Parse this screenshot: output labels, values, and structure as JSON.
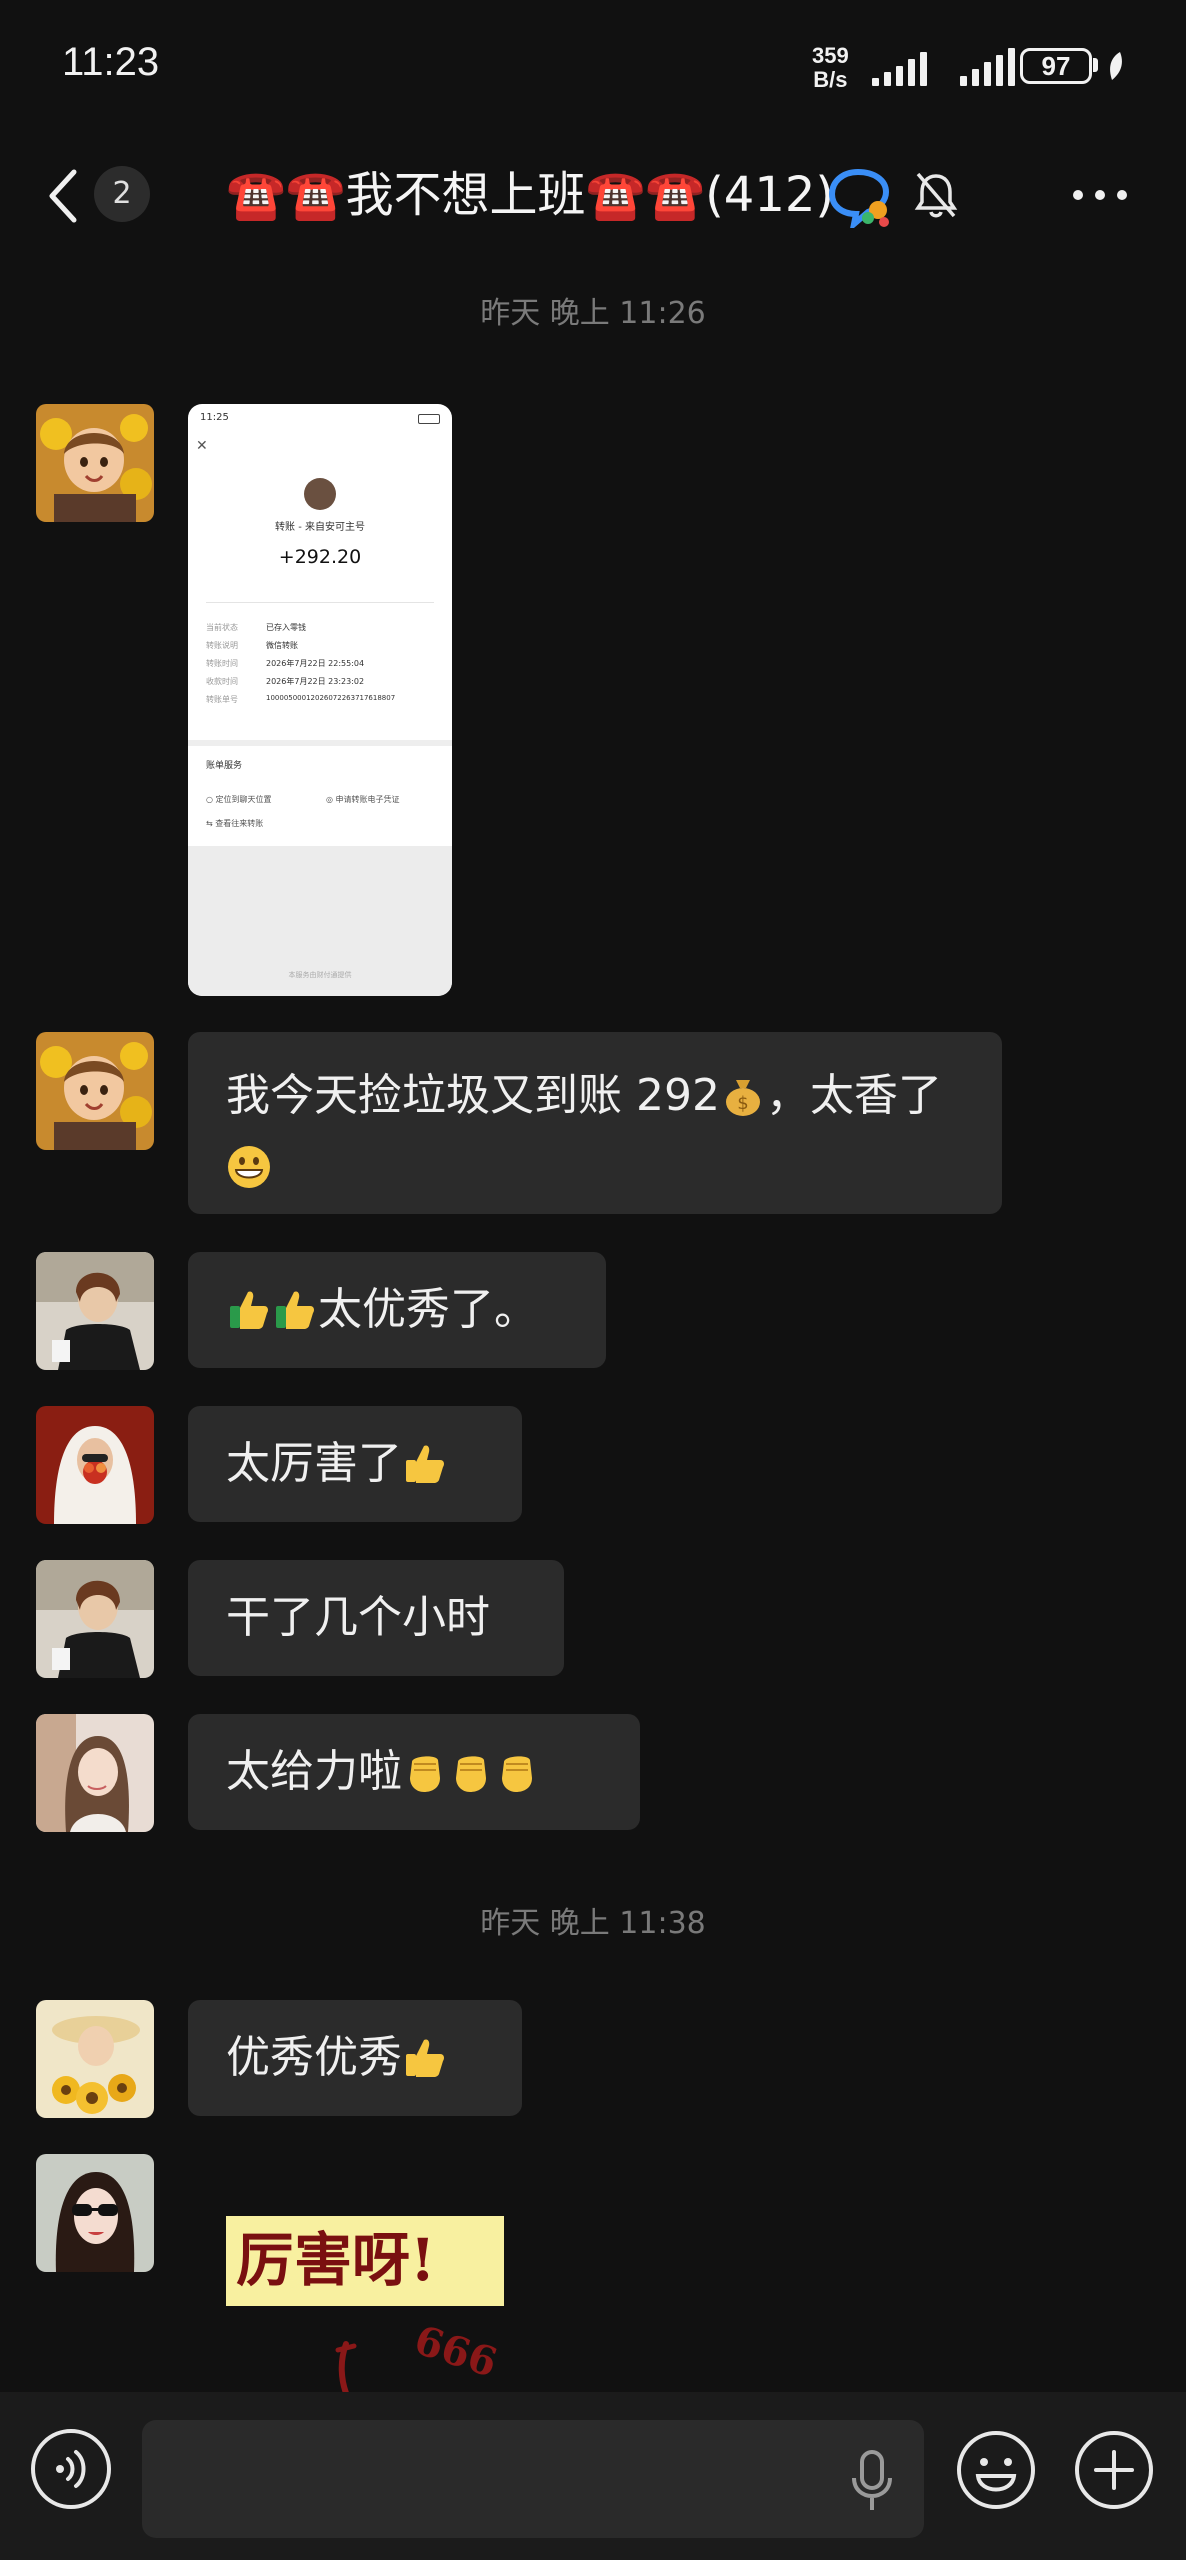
{
  "status_bar": {
    "time": "11:23",
    "net_speed_value": "359",
    "net_speed_unit": "B/s",
    "battery": "97"
  },
  "header": {
    "back_label": "back",
    "unread_count": "2",
    "title": "☎️☎️我不想上班☎️☎️(412)"
  },
  "messages": {
    "timestamp_1": "昨天 晚上 11:26",
    "transfer_image": {
      "time": "11:25",
      "from": "转账 - 来自安可主号",
      "amount": "+292.20",
      "rows": [
        {
          "label": "当前状态",
          "value": "已存入零钱"
        },
        {
          "label": "转账说明",
          "value": "微信转账"
        },
        {
          "label": "转账时间",
          "value": "2026年7月22日 22:55:04"
        },
        {
          "label": "收款时间",
          "value": "2026年7月22日 23:23:02"
        },
        {
          "label": "转账单号",
          "value": "10000500012026072263717618807"
        }
      ],
      "service_title": "账单服务",
      "svc_1": "定位到聊天位置",
      "svc_2": "申请转账电子凭证",
      "svc_3": "查看往来转账",
      "footer": "本服务由财付通提供"
    },
    "msg_1": "我今天捡垃圾又到账 292",
    "msg_1_tail": "，太香了",
    "msg_2": "太优秀了。",
    "msg_3": "太厉害了",
    "msg_4": "干了几个小时",
    "msg_5": "太给力啦",
    "timestamp_2": "昨天 晚上 11:38",
    "msg_6": "优秀优秀",
    "sticker_text": "厉害呀!",
    "sticker_sub": "666"
  },
  "colors": {
    "background": "#111111",
    "bubble": "#2b2b2b",
    "timestamp": "#7a7a7a",
    "text": "#f0f0f0"
  },
  "icons": [
    "back-icon",
    "qq-icon",
    "mute-icon",
    "more-icon",
    "voice-icon",
    "mic-icon",
    "emoji-icon",
    "plus-icon"
  ]
}
